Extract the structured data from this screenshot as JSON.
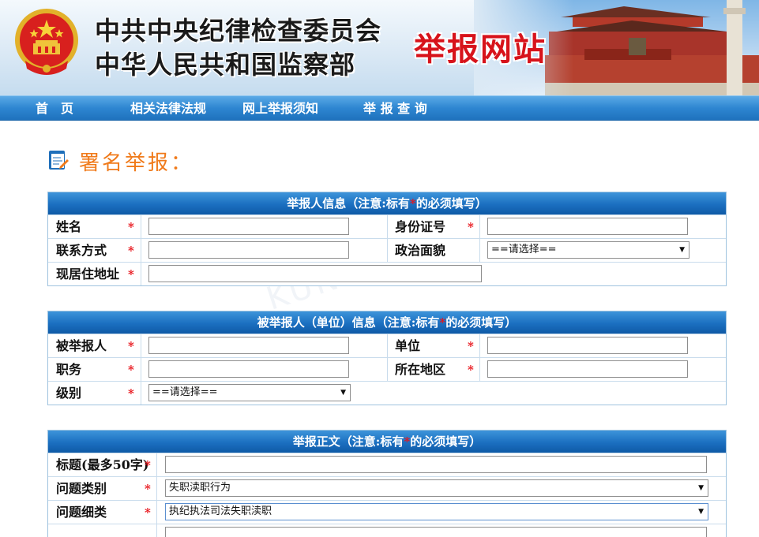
{
  "header": {
    "org_line1": "中共中央纪律检查委员会",
    "org_line2": "中华人民共和国监察部",
    "site_title": "举报网站"
  },
  "nav": {
    "items": [
      "首　页",
      "相关法律法规",
      "网上举报须知",
      "举 报 查 询"
    ]
  },
  "page_title": "署名举报：",
  "section1": {
    "head_prefix": "举报人信息（注意:标有",
    "head_suffix": "的必须填写）",
    "rows": [
      {
        "label_left": "姓名",
        "label_right": "身份证号"
      },
      {
        "label_left": "联系方式",
        "label_right": "政治面貌",
        "select_right": "==请选择=="
      },
      {
        "label_left": "现居住地址"
      }
    ]
  },
  "section2": {
    "head_prefix": "被举报人（单位）信息（注意:标有",
    "head_suffix": "的必须填写）",
    "rows": [
      {
        "label_left": "被举报人",
        "label_right": "单位"
      },
      {
        "label_left": "职务",
        "label_right": "所在地区"
      },
      {
        "label_left": "级别",
        "select_left": "==请选择=="
      }
    ]
  },
  "section3": {
    "head_prefix": "举报正文（注意:标有",
    "head_suffix": "的必须填写）",
    "rows": [
      {
        "label": "标题(最多50字)"
      },
      {
        "label": "问题类别",
        "select": "失职渎职行为"
      },
      {
        "label": "问题细类",
        "select": "执纪执法司法失职渎职"
      }
    ]
  },
  "required_mark": "*",
  "colors": {
    "nav_blue": "#2e86d1",
    "header_red": "#d7131b",
    "title_orange": "#f07a1a",
    "required_red": "#e8141b"
  }
}
